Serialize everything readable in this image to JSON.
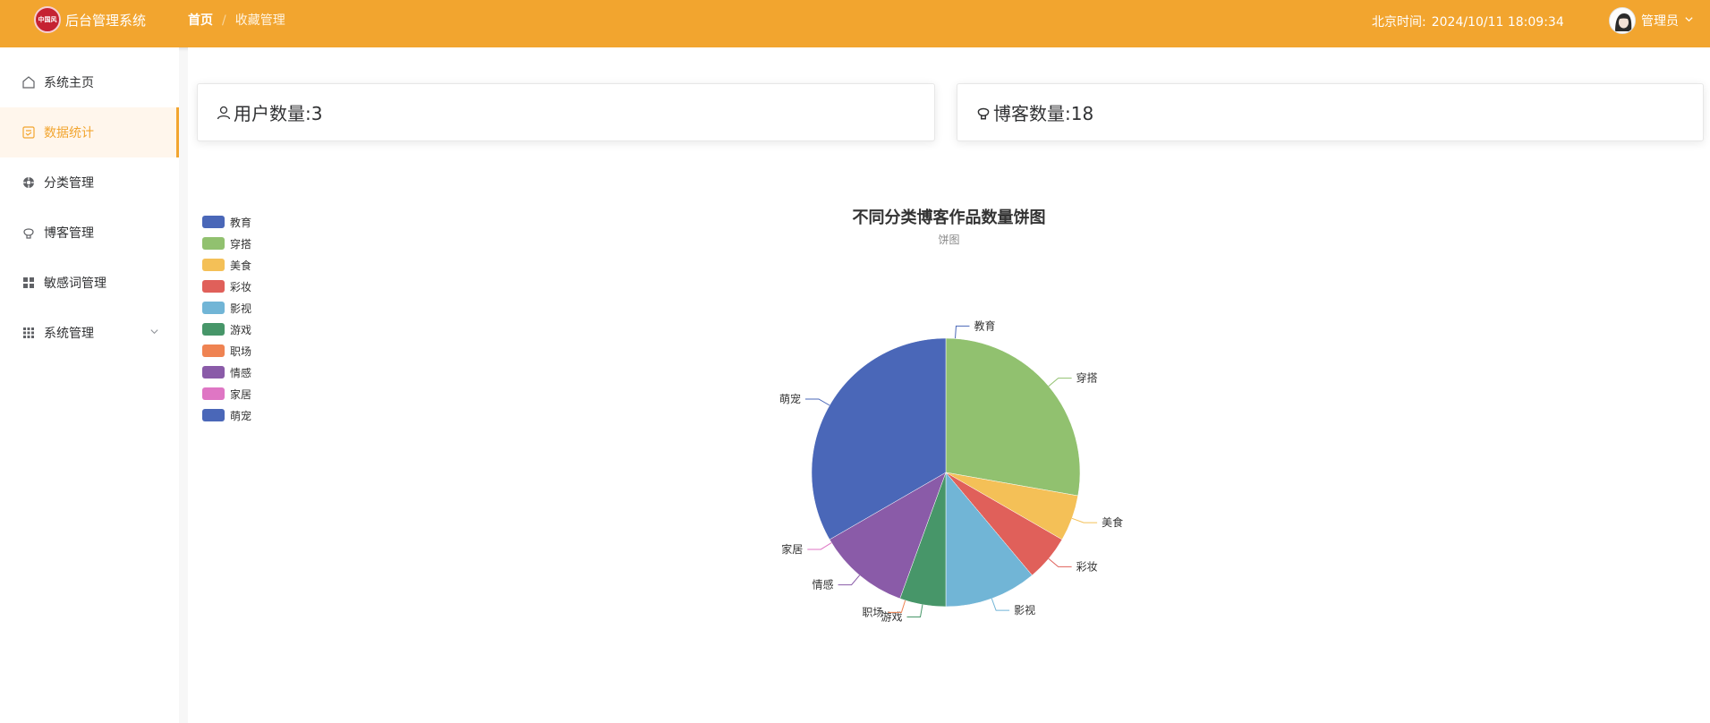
{
  "header": {
    "logo_text": "中国风",
    "app_title": "后台管理系统",
    "breadcrumb": [
      "首页",
      "收藏管理"
    ],
    "breadcrumb_sep": "/",
    "clock_label": "北京时间:",
    "clock_value": "2024/10/11 18:09:34",
    "user_name": "管理员"
  },
  "sidebar": {
    "items": [
      {
        "label": "系统主页",
        "icon": "home-icon"
      },
      {
        "label": "数据统计",
        "icon": "chart-icon"
      },
      {
        "label": "分类管理",
        "icon": "category-icon"
      },
      {
        "label": "博客管理",
        "icon": "blog-icon"
      },
      {
        "label": "敏感词管理",
        "icon": "grid-icon"
      },
      {
        "label": "系统管理",
        "icon": "apps-icon"
      }
    ],
    "active_index": 1
  },
  "stats": {
    "user_count_label": "用户数量:3",
    "blog_count_label": "博客数量:18"
  },
  "colors": {
    "accent": "#f2a52f",
    "series": [
      "#4a67b8",
      "#91c16f",
      "#f4c057",
      "#e0605a",
      "#71b5d6",
      "#479669",
      "#ef8352",
      "#8a5ba8",
      "#df76c4",
      "#4a67b8"
    ]
  },
  "chart_data": {
    "type": "pie",
    "title": "不同分类博客作品数量饼图",
    "subtitle": "饼图",
    "legend_position": "top-left",
    "categories": [
      "教育",
      "穿搭",
      "美食",
      "彩妆",
      "影视",
      "游戏",
      "职场",
      "情感",
      "家居",
      "萌宠"
    ],
    "values": [
      0,
      5,
      1,
      1,
      2,
      1,
      0,
      2,
      0,
      6
    ]
  }
}
